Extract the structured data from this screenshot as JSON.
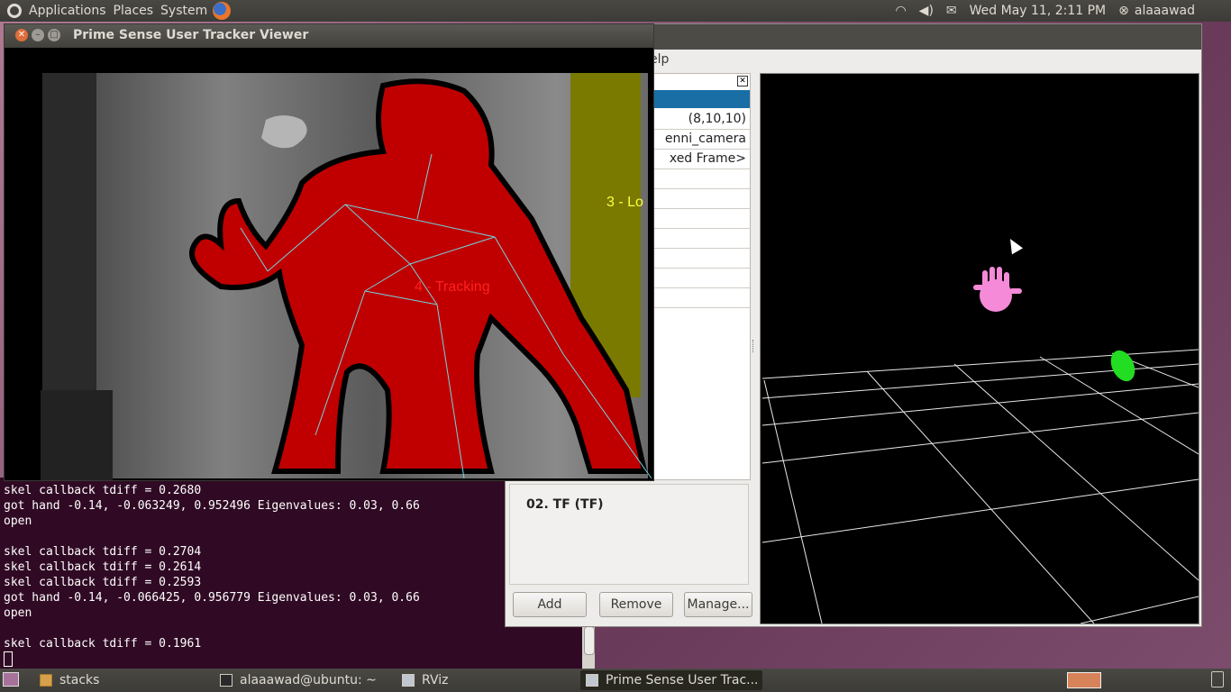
{
  "top_panel": {
    "menus": [
      "Applications",
      "Places",
      "System"
    ],
    "datetime": "Wed May 11, 2:11 PM",
    "user": "alaaawad",
    "icons": [
      "ubuntu-logo-icon",
      "firefox-icon",
      "wifi-icon",
      "volume-icon",
      "mail-icon",
      "user-icon"
    ]
  },
  "prime_sense_window": {
    "title": "Prime Sense User Tracker Viewer",
    "label_tracking": "4 - Tracking",
    "label_lost": "3 - Lo"
  },
  "terminal": {
    "lines": [
      "skel callback tdiff = 0.2680",
      "got hand -0.14, -0.063249, 0.952496 Eigenvalues: 0.03, 0.66",
      "open",
      "",
      "skel callback tdiff = 0.2704",
      "skel callback tdiff = 0.2614",
      "skel callback tdiff = 0.2593",
      "got hand -0.14, -0.066425, 0.956779 Eigenvalues: 0.03, 0.66",
      "open",
      "",
      "skel callback tdiff = 0.1961"
    ]
  },
  "rviz": {
    "menu_partial": "elp",
    "properties": [
      "(8,10,10)",
      "enni_camera",
      "xed Frame>"
    ],
    "description_title": "02. TF (TF)",
    "buttons": {
      "add": "Add",
      "remove": "Remove",
      "manage": "Manage..."
    }
  },
  "taskbar": {
    "tasks": [
      {
        "label": "stacks",
        "icon": "folder-icon"
      },
      {
        "label": "alaaawad@ubuntu: ~",
        "icon": "terminal-icon"
      },
      {
        "label": "RViz",
        "icon": "window-icon"
      },
      {
        "label": "Prime Sense User Trac...",
        "icon": "window-icon"
      }
    ]
  },
  "colors": {
    "user_tracked": "#c00000",
    "user_other": "#7a7a00",
    "skeleton": "#6fd6e0",
    "hand_marker": "#f58ad8",
    "hand_marker_2": "#22dd22",
    "terminal_bg": "#300a24"
  }
}
